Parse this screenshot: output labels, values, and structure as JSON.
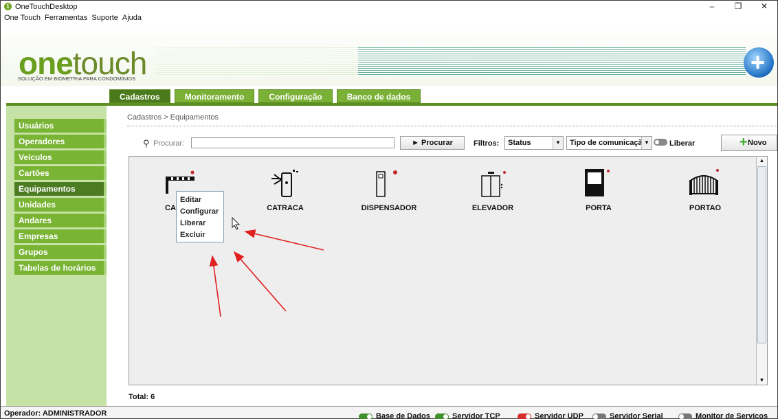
{
  "window": {
    "title": "OneTouchDesktop",
    "minimize": "–",
    "maximize": "❐",
    "close": "✕"
  },
  "menu": [
    "One Touch",
    "Ferramentas",
    "Suporte",
    "Ajuda"
  ],
  "brand": {
    "logo_one": "one",
    "logo_touch": "touch",
    "tagline": "SOLUÇÃO EM BIOMETRIA PARA CONDOMÍNIOS"
  },
  "tabs": [
    "Cadastros",
    "Monitoramento",
    "Configuração",
    "Banco de dados"
  ],
  "active_tab": "Cadastros",
  "sidebar": [
    "Usuários",
    "Operadores",
    "Veículos",
    "Cartões",
    "Equipamentos",
    "Unidades",
    "Andares",
    "Empresas",
    "Grupos",
    "Tabelas de horários"
  ],
  "active_sidebar": "Equipamentos",
  "breadcrumb": "Cadastros > Equipamentos",
  "toolbar": {
    "search_label": "Procurar:",
    "search_value": "",
    "search_button": "► Procurar",
    "filters_label": "Filtros:",
    "status_select": "Status",
    "tipo_select": "Tipo de comunicação",
    "liberar_label": "Liberar",
    "novo_button": "Novo"
  },
  "equipments": [
    {
      "label": "CAN",
      "icon": "barrier-gate-icon"
    },
    {
      "label": "CATRACA",
      "icon": "turnstile-icon"
    },
    {
      "label": "DISPENSADOR",
      "icon": "dispenser-icon"
    },
    {
      "label": "ELEVADOR",
      "icon": "elevator-icon"
    },
    {
      "label": "PORTA",
      "icon": "door-icon"
    },
    {
      "label": "PORTAO",
      "icon": "gate-icon"
    }
  ],
  "context_menu": [
    "Editar",
    "Configurar",
    "Liberar",
    "Excluir"
  ],
  "total": "Total: 6",
  "status": {
    "operator": "Operador: ADMINISTRADOR",
    "services": [
      {
        "label": "Base de Dados",
        "state": "green"
      },
      {
        "label": "Servidor TCP",
        "state": "green"
      },
      {
        "label": "Servidor UDP",
        "state": "red"
      },
      {
        "label": "Servidor Serial",
        "state": "gray"
      },
      {
        "label": "Monitor de Servicos",
        "state": "gray"
      }
    ]
  },
  "colors": {
    "accent": "#79b035",
    "accent_dark": "#4a7a1c",
    "sidebar_bg": "#c6e2a6",
    "status_red": "#c0282c"
  }
}
